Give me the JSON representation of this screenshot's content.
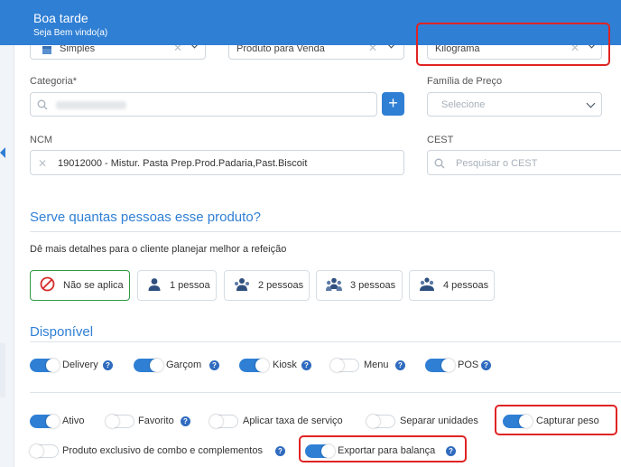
{
  "header": {
    "title": "Boa tarde",
    "subtitle": "Seja Bem vindo(a)"
  },
  "top_fields": {
    "type_value": "Simples",
    "product_kind_value": "Produto para Venda",
    "unit_value": "Kilograma"
  },
  "categoria": {
    "label": "Categoria*",
    "add_label": "+"
  },
  "familia": {
    "label": "Família de Preço",
    "placeholder": "Selecione"
  },
  "ncm": {
    "label": "NCM",
    "value": "19012000 - Mistur. Pasta Prep.Prod.Padaria,Past.Biscoit"
  },
  "cest": {
    "label": "CEST",
    "placeholder": "Pesquisar o CEST"
  },
  "serves": {
    "title": "Serve quantas pessoas esse produto?",
    "description": "Dê mais detalhes para o cliente planejar melhor a refeição",
    "options": [
      "Não se aplica",
      "1 pessoa",
      "2 pessoas",
      "3 pessoas",
      "4 pessoas"
    ],
    "selected": "Não se aplica"
  },
  "disponivel": {
    "title": "Disponível",
    "channels": [
      {
        "label": "Delivery",
        "on": true
      },
      {
        "label": "Garçom",
        "on": true
      },
      {
        "label": "Kiosk",
        "on": true
      },
      {
        "label": "Menu",
        "on": false
      },
      {
        "label": "POS",
        "on": true
      }
    ]
  },
  "flags": [
    {
      "label": "Ativo",
      "on": true
    },
    {
      "label": "Favorito",
      "on": false
    },
    {
      "label": "Aplicar taxa de serviço",
      "on": false
    },
    {
      "label": "Separar unidades",
      "on": false
    },
    {
      "label": "Capturar peso",
      "on": true
    },
    {
      "label": "Produto exclusivo de combo e complementos",
      "on": false
    },
    {
      "label": "Exportar para balança",
      "on": true
    }
  ],
  "colors": {
    "brand": "#2f7fd4",
    "selected_border": "#2e9a47",
    "highlight": "#e02424"
  },
  "icons": {
    "search": "search-icon",
    "chevron": "chevron-down-icon",
    "clear": "close-icon",
    "not_applicable": "prohibited-icon",
    "person": "person-icon",
    "help": "question-icon"
  }
}
